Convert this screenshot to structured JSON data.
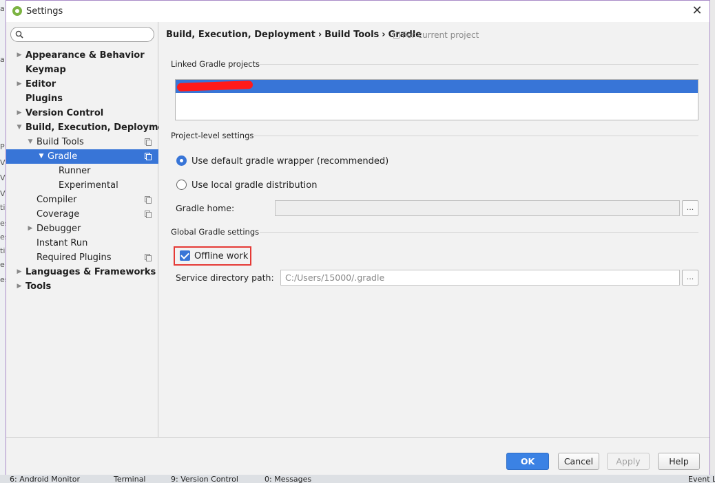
{
  "window": {
    "title": "Settings"
  },
  "background": {
    "left_glyphs": [
      "a",
      "a",
      "P",
      "V",
      "V",
      "V",
      "ti",
      "es",
      "es",
      "ti",
      "e",
      "es"
    ],
    "bottom_items": [
      "6: Android Monitor",
      "Terminal",
      "9: Version Control",
      "0: Messages",
      "Event L"
    ]
  },
  "search": {
    "placeholder": "",
    "value": ""
  },
  "tree": [
    {
      "label": "Appearance & Behavior",
      "bold": true,
      "level": 0,
      "expander": "collapsed",
      "project_icon": false,
      "selected": false
    },
    {
      "label": "Keymap",
      "bold": true,
      "level": 0,
      "expander": "none",
      "project_icon": false,
      "selected": false
    },
    {
      "label": "Editor",
      "bold": true,
      "level": 0,
      "expander": "collapsed",
      "project_icon": false,
      "selected": false
    },
    {
      "label": "Plugins",
      "bold": true,
      "level": 0,
      "expander": "none",
      "project_icon": false,
      "selected": false
    },
    {
      "label": "Version Control",
      "bold": true,
      "level": 0,
      "expander": "collapsed",
      "project_icon": false,
      "selected": false
    },
    {
      "label": "Build, Execution, Deployment",
      "bold": true,
      "level": 0,
      "expander": "expanded",
      "project_icon": false,
      "selected": false
    },
    {
      "label": "Build Tools",
      "bold": false,
      "level": 1,
      "expander": "expanded",
      "project_icon": true,
      "selected": false
    },
    {
      "label": "Gradle",
      "bold": false,
      "level": 2,
      "expander": "expanded",
      "project_icon": true,
      "selected": true
    },
    {
      "label": "Runner",
      "bold": false,
      "level": 3,
      "expander": "none",
      "project_icon": false,
      "selected": false
    },
    {
      "label": "Experimental",
      "bold": false,
      "level": 3,
      "expander": "none",
      "project_icon": false,
      "selected": false
    },
    {
      "label": "Compiler",
      "bold": false,
      "level": 1,
      "expander": "none",
      "project_icon": true,
      "selected": false
    },
    {
      "label": "Coverage",
      "bold": false,
      "level": 1,
      "expander": "none",
      "project_icon": true,
      "selected": false
    },
    {
      "label": "Debugger",
      "bold": false,
      "level": 1,
      "expander": "collapsed",
      "project_icon": false,
      "selected": false
    },
    {
      "label": "Instant Run",
      "bold": false,
      "level": 1,
      "expander": "none",
      "project_icon": false,
      "selected": false
    },
    {
      "label": "Required Plugins",
      "bold": false,
      "level": 1,
      "expander": "none",
      "project_icon": true,
      "selected": false
    },
    {
      "label": "Languages & Frameworks",
      "bold": true,
      "level": 0,
      "expander": "collapsed",
      "project_icon": false,
      "selected": false
    },
    {
      "label": "Tools",
      "bold": true,
      "level": 0,
      "expander": "collapsed",
      "project_icon": false,
      "selected": false
    }
  ],
  "breadcrumb": {
    "items": [
      "Build, Execution, Deployment",
      "Build Tools",
      "Gradle"
    ],
    "separator": "›",
    "scope": "For current project"
  },
  "linked_projects": {
    "title": "Linked Gradle projects",
    "selected_row_redacted": true
  },
  "project_level": {
    "title": "Project-level settings",
    "option_default": "Use default gradle wrapper (recommended)",
    "option_local": "Use local gradle distribution",
    "selected": "default",
    "gradle_home_label": "Gradle home:",
    "gradle_home_value": "",
    "browse_label": "..."
  },
  "global": {
    "title": "Global Gradle settings",
    "offline_work_label": "Offline work",
    "offline_work_checked": true,
    "service_dir_label": "Service directory path:",
    "service_dir_value": "C:/Users/15000/.gradle",
    "browse_label": "..."
  },
  "buttons": {
    "ok": "OK",
    "cancel": "Cancel",
    "apply": "Apply",
    "help": "Help"
  },
  "colors": {
    "accent": "#3875d7",
    "highlight_box": "#e53935",
    "redaction": "#ff1a1a",
    "window_border": "#a98bc7"
  }
}
